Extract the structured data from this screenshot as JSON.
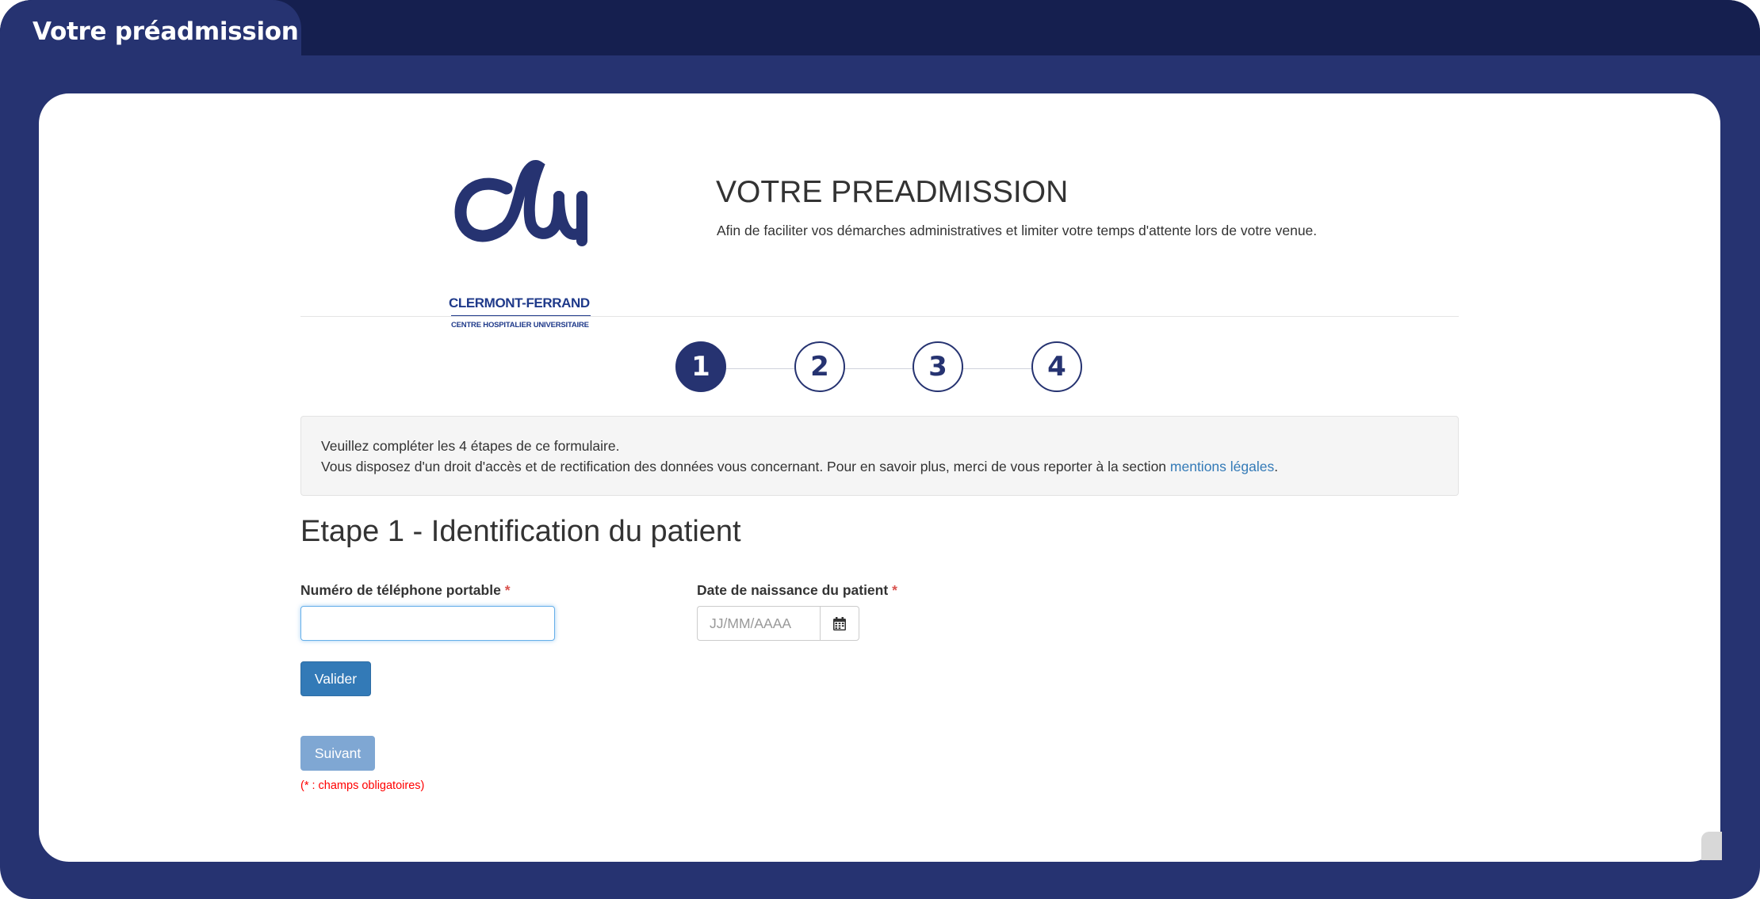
{
  "window": {
    "tab_title": "Votre préadmission"
  },
  "header": {
    "logo": {
      "name": "CLERMONT-FERRAND",
      "subtitle": "CENTRE HOSPITALIER UNIVERSITAIRE",
      "mark_text": "chu"
    },
    "title": "VOTRE PREADMISSION",
    "subtitle": "Afin de faciliter vos démarches administratives et limiter votre temps d'attente lors de votre venue."
  },
  "stepper": {
    "steps": [
      "1",
      "2",
      "3",
      "4"
    ],
    "active_step": 1
  },
  "info": {
    "line1": "Veuillez compléter les 4 étapes de ce formulaire.",
    "line2_prefix": "Vous disposez d'un droit d'accès et de rectification des données vous concernant. Pour en savoir plus, merci de vous reporter à la section ",
    "link_text": "mentions légales",
    "line2_suffix": "."
  },
  "form": {
    "step_title": "Etape 1 - Identification du patient",
    "phone_label": "Numéro de téléphone portable",
    "phone_value": "",
    "birthdate_label": "Date de naissance du patient",
    "birthdate_placeholder": "JJ/MM/AAAA",
    "required_marker": "*",
    "validate_label": "Valider",
    "next_label": "Suivant",
    "required_note": "(* : champs obligatoires)"
  },
  "colors": {
    "brand_navy": "#263371",
    "primary_button": "#337ab7",
    "link": "#337ab7",
    "required": "#ff0000"
  },
  "icons": {
    "calendar": "calendar-icon"
  }
}
